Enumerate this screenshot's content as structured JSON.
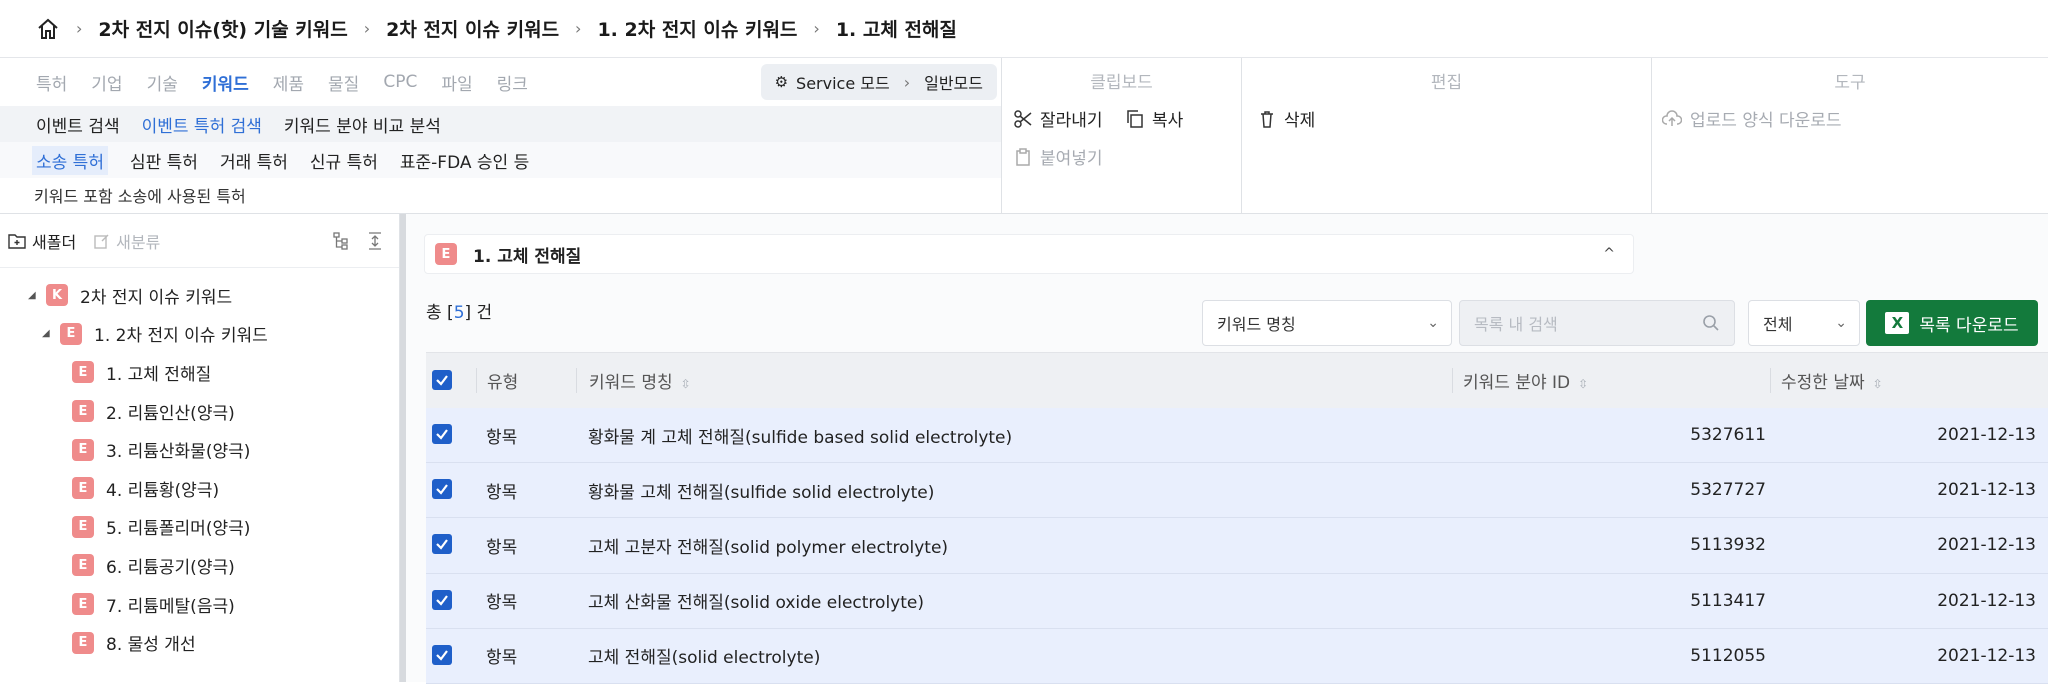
{
  "breadcrumb": [
    "2차 전지 이슈(핫) 기술 키워드",
    "2차 전지 이슈 키워드",
    "1. 2차 전지 이슈 키워드",
    "1. 고체 전해질"
  ],
  "ribbon": {
    "tabs": [
      "특허",
      "기업",
      "기술",
      "키워드",
      "제품",
      "물질",
      "CPC",
      "파일",
      "링크"
    ],
    "active_tab": "키워드",
    "mode": {
      "service": "Service 모드",
      "normal": "일반모드"
    },
    "row2": [
      "이벤트 검색",
      "이벤트 특허 검색",
      "키워드 분야 비교 분석"
    ],
    "row3": [
      "소송 특허",
      "심판 특허",
      "거래 특허",
      "신규 특허",
      "표준-FDA 승인 등"
    ],
    "row4": "키워드 포함 소송에 사용된 특허",
    "clipboard": {
      "title": "클립보드",
      "cut": "잘라내기",
      "copy": "복사",
      "paste": "붙여넣기"
    },
    "edit": {
      "title": "편집",
      "delete": "삭제"
    },
    "tools": {
      "title": "도구",
      "upload": "업로드 양식 다운로드"
    }
  },
  "sidebar": {
    "new_folder": "새폴더",
    "new_category": "새분류",
    "root": {
      "badge": "K",
      "label": "2차 전지 이슈 키워드"
    },
    "child": {
      "badge": "E",
      "label": "1. 2차 전지 이슈 키워드"
    },
    "items": [
      "1. 고체 전해질",
      "2. 리튬인산(양극)",
      "3. 리튬산화물(양극)",
      "4. 리튬황(양극)",
      "5. 리튬폴리머(양극)",
      "6. 리튬공기(양극)",
      "7. 리튬메탈(음극)",
      "8. 물성 개선"
    ]
  },
  "main": {
    "panel_title": "1. 고체 전해질",
    "count_prefix": "총 [",
    "count": "5",
    "count_suffix": "] 건",
    "field_select": "키워드 명칭",
    "search_placeholder": "목록 내 검색",
    "scope_select": "전체",
    "download": "목록 다운로드",
    "columns": [
      "유형",
      "키워드 명칭",
      "키워드 분야 ID",
      "수정한 날짜"
    ],
    "rows": [
      {
        "type": "항목",
        "name": "황화물 계 고체 전해질(sulfide based solid electrolyte)",
        "id": "5327611",
        "date": "2021-12-13"
      },
      {
        "type": "항목",
        "name": "황화물 고체 전해질(sulfide solid electrolyte)",
        "id": "5327727",
        "date": "2021-12-13"
      },
      {
        "type": "항목",
        "name": "고체 고분자 전해질(solid polymer electrolyte)",
        "id": "5113932",
        "date": "2021-12-13"
      },
      {
        "type": "항목",
        "name": "고체 산화물 전해질(solid oxide electrolyte)",
        "id": "5113417",
        "date": "2021-12-13"
      },
      {
        "type": "항목",
        "name": "고체 전해질(solid electrolyte)",
        "id": "5112055",
        "date": "2021-12-13"
      }
    ]
  }
}
